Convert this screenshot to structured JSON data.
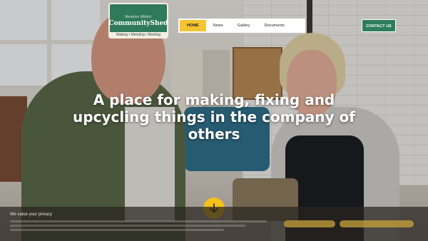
{
  "logo": {
    "arc_text": "Newton Abbot",
    "name": "CommunityShed",
    "tagline": "Making • Mending • Meeting"
  },
  "nav": {
    "items": [
      {
        "label": "HOME",
        "active": true
      },
      {
        "label": "News",
        "active": false
      },
      {
        "label": "Gallery",
        "active": false
      },
      {
        "label": "Documents",
        "active": false
      }
    ]
  },
  "contact_button": {
    "label": "CONTACT US"
  },
  "hero": {
    "heading": "A place for making, fixing and upcycling things in the company of others"
  },
  "scroll_icon": "arrow-down-icon",
  "privacy_banner": {
    "title": "We value your privacy"
  },
  "colors": {
    "accent_yellow": "#f6c431",
    "brand_green": "#2e7d5b"
  }
}
